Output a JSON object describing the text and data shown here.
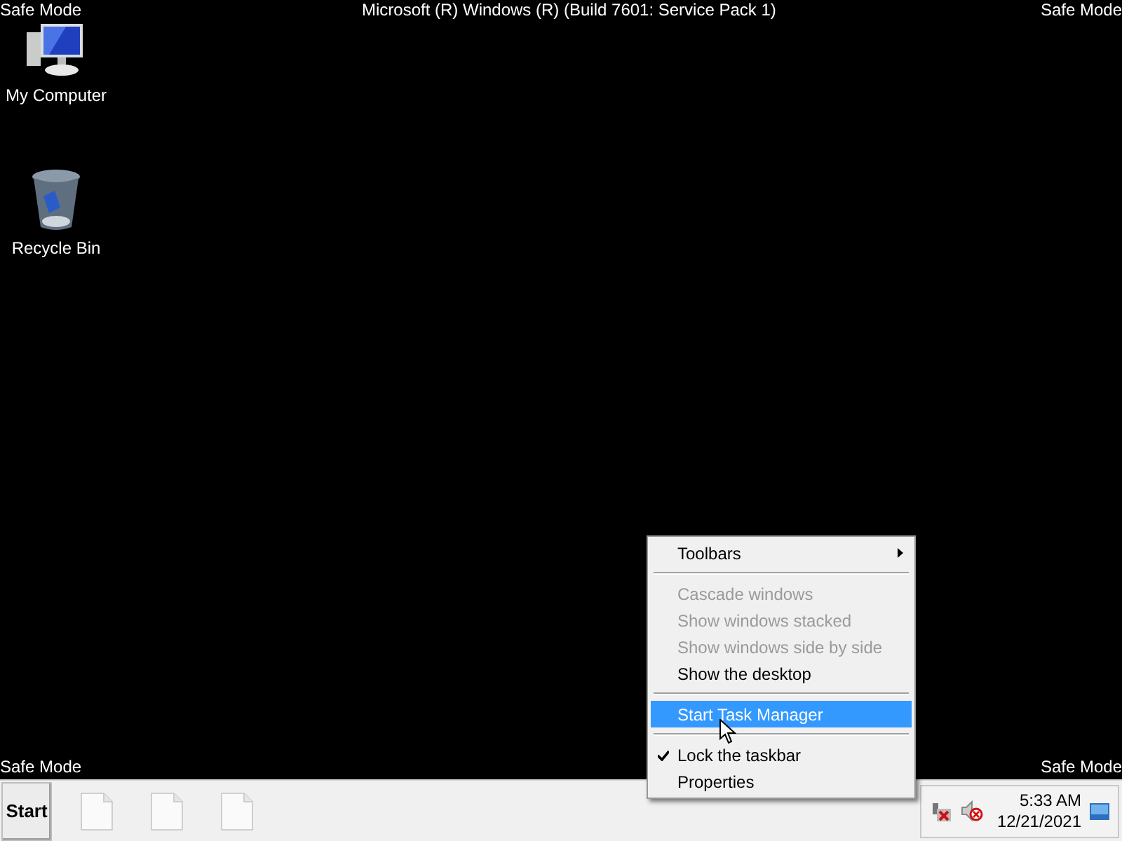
{
  "overlay_labels": {
    "top_left": "Safe Mode",
    "top_center": "Microsoft (R) Windows (R) (Build 7601: Service Pack 1)",
    "top_right": "Safe Mode",
    "bottom_left": "Safe Mode",
    "bottom_right": "Safe Mode"
  },
  "desktop_icons": [
    {
      "kind": "computer",
      "label": "My Computer"
    },
    {
      "kind": "recycle-bin",
      "label": "Recycle Bin"
    }
  ],
  "context_menu": {
    "items": [
      {
        "kind": "item",
        "label": "Toolbars",
        "submenu": true,
        "disabled": false,
        "checked": false,
        "selected": false
      },
      {
        "kind": "separator"
      },
      {
        "kind": "item",
        "label": "Cascade windows",
        "submenu": false,
        "disabled": true,
        "checked": false,
        "selected": false
      },
      {
        "kind": "item",
        "label": "Show windows stacked",
        "submenu": false,
        "disabled": true,
        "checked": false,
        "selected": false
      },
      {
        "kind": "item",
        "label": "Show windows side by side",
        "submenu": false,
        "disabled": true,
        "checked": false,
        "selected": false
      },
      {
        "kind": "item",
        "label": "Show the desktop",
        "submenu": false,
        "disabled": false,
        "checked": false,
        "selected": false
      },
      {
        "kind": "separator"
      },
      {
        "kind": "item",
        "label": "Start Task Manager",
        "submenu": false,
        "disabled": false,
        "checked": false,
        "selected": true
      },
      {
        "kind": "separator"
      },
      {
        "kind": "item",
        "label": "Lock the taskbar",
        "submenu": false,
        "disabled": false,
        "checked": true,
        "selected": false
      },
      {
        "kind": "item",
        "label": "Properties",
        "submenu": false,
        "disabled": false,
        "checked": false,
        "selected": false
      }
    ]
  },
  "taskbar": {
    "start_label": "Start",
    "window_buttons": [
      {
        "kind": "document"
      },
      {
        "kind": "document"
      },
      {
        "kind": "document"
      }
    ],
    "clock": {
      "time": "5:33 AM",
      "date": "12/21/2021"
    }
  }
}
